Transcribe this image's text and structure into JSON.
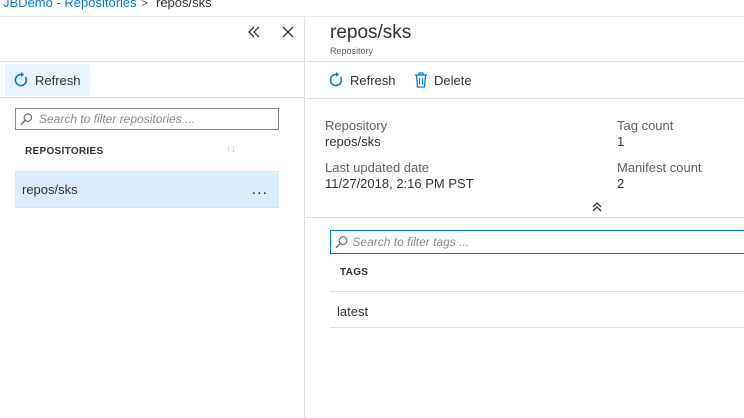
{
  "breadcrumb": {
    "parent": "JBDemo - Repositories",
    "separator": ">",
    "current": "repos/sks"
  },
  "left_blade": {
    "refresh_label": "Refresh",
    "search_placeholder": "Search to filter repositories ...",
    "column_header": "REPOSITORIES",
    "sort_icon": "↑↓",
    "rows": [
      {
        "label": "repos/sks",
        "menu": "..."
      }
    ]
  },
  "right_blade": {
    "title": "repos/sks",
    "subtitle": "Repository",
    "refresh_label": "Refresh",
    "delete_label": "Delete",
    "essentials": {
      "repository_label": "Repository",
      "repository_value": "repos/sks",
      "updated_label": "Last updated date",
      "updated_value": "11/27/2018, 2:16 PM PST",
      "tag_count_label": "Tag count",
      "tag_count_value": "1",
      "manifest_count_label": "Manifest count",
      "manifest_count_value": "2"
    },
    "search_placeholder": "Search to filter tags ...",
    "column_header": "TAGS",
    "tags": [
      "latest"
    ]
  },
  "colors": {
    "accent": "#0078d4",
    "selected_row": "#dcebf9",
    "border": "#e1dfdd"
  },
  "icons": [
    "collapse-double-chevron-icon",
    "close-icon",
    "refresh-icon",
    "search-icon",
    "trash-icon",
    "chevron-up-double-icon"
  ]
}
